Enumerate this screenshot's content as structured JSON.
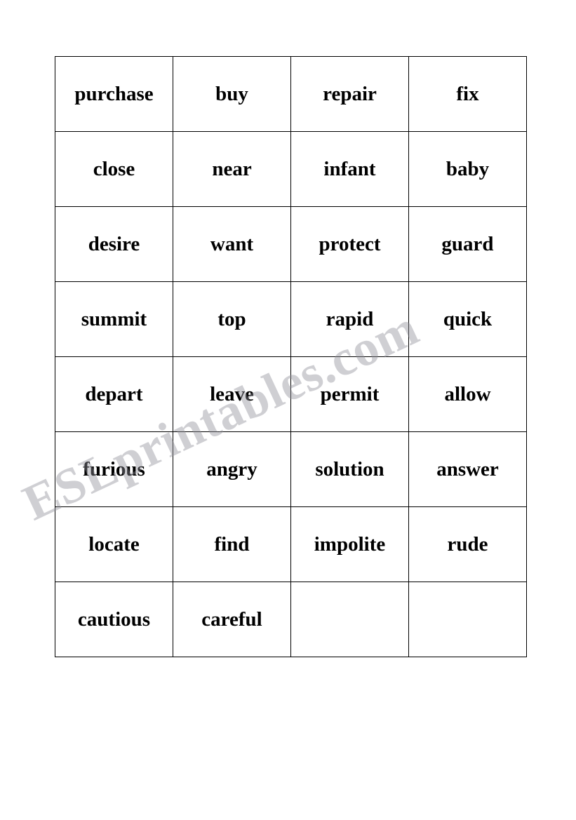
{
  "document": {
    "type": "worksheet",
    "watermark": "ESLprintables.com",
    "table": {
      "columns": 4,
      "rows": [
        [
          "purchase",
          "buy",
          "repair",
          "fix"
        ],
        [
          "close",
          "near",
          "infant",
          "baby"
        ],
        [
          "desire",
          "want",
          "protect",
          "guard"
        ],
        [
          "summit",
          "top",
          "rapid",
          "quick"
        ],
        [
          "depart",
          "leave",
          "permit",
          "allow"
        ],
        [
          "furious",
          "angry",
          "solution",
          "answer"
        ],
        [
          "locate",
          "find",
          "impolite",
          "rude"
        ],
        [
          "cautious",
          "careful",
          "",
          ""
        ]
      ]
    }
  }
}
